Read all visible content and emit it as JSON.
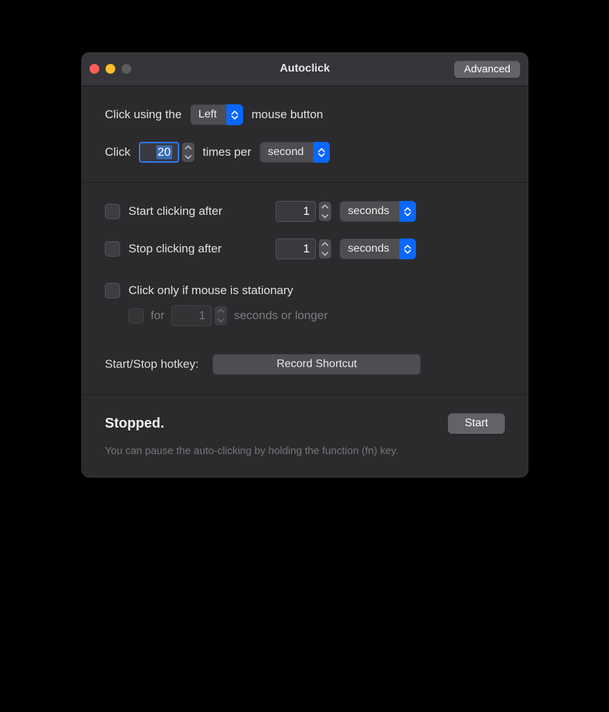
{
  "window": {
    "title": "Autoclick"
  },
  "titlebar": {
    "advanced": "Advanced"
  },
  "section1": {
    "click_using_pre": "Click using the",
    "mouse_button_select": "Left",
    "click_using_post": "mouse button",
    "click_pre": "Click",
    "click_count": "20",
    "times_per": "times per",
    "time_unit_select": "second"
  },
  "section2": {
    "start_after_label": "Start clicking after",
    "start_after_value": "1",
    "start_after_unit": "seconds",
    "stop_after_label": "Stop clicking after",
    "stop_after_value": "1",
    "stop_after_unit": "seconds",
    "stationary_label": "Click only if mouse is stationary",
    "stationary_for_label": "for",
    "stationary_for_value": "1",
    "stationary_for_post": "seconds or longer",
    "hotkey_label": "Start/Stop hotkey:",
    "record_shortcut": "Record Shortcut"
  },
  "section3": {
    "status": "Stopped.",
    "start_button": "Start",
    "hint": "You can pause the auto-clicking by holding the function (fn) key."
  }
}
